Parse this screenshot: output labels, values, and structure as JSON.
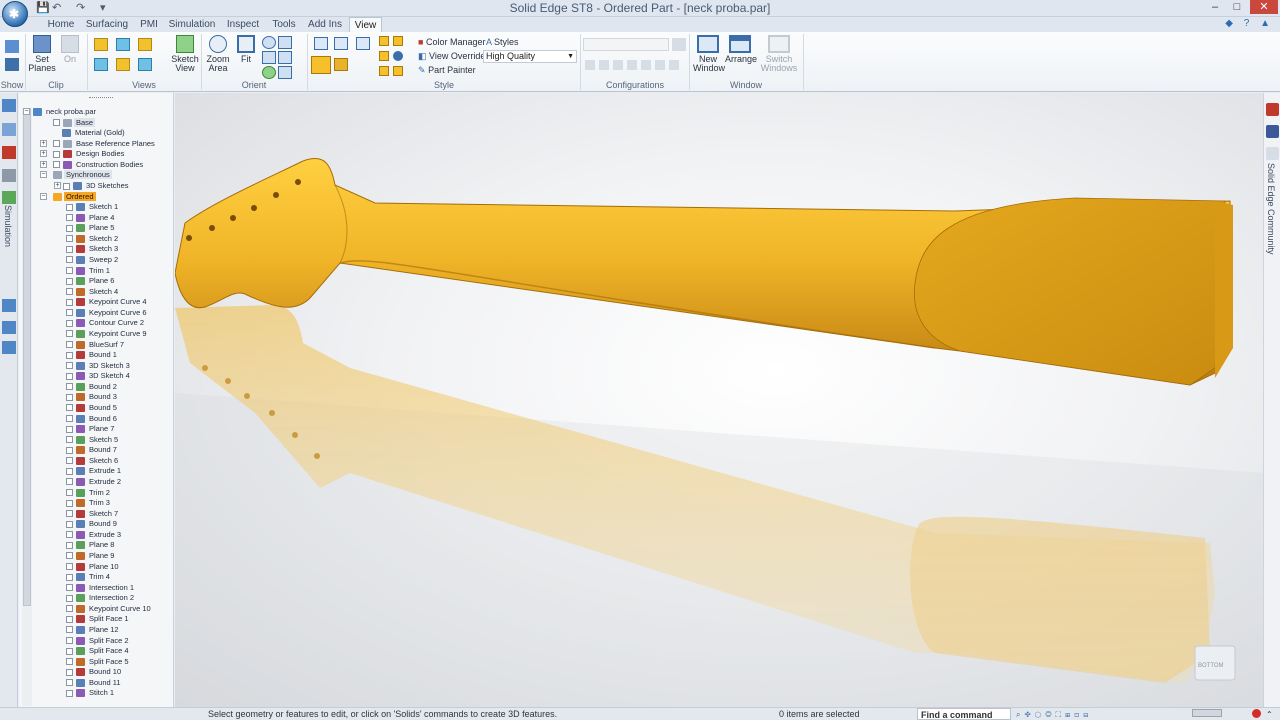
{
  "window": {
    "title": "Solid Edge ST8 - Ordered Part - [neck proba.par]",
    "controls": [
      "–",
      "□",
      "✕"
    ]
  },
  "ribbon": {
    "tabs": [
      "Home",
      "Surfacing",
      "PMI",
      "Simulation",
      "Inspect",
      "Tools",
      "Add Ins",
      "View"
    ],
    "active_tab": "View",
    "groups": {
      "show": "Show",
      "clip": "Clip",
      "views": "Views",
      "orient": "Orient",
      "style": "Style",
      "configurations": "Configurations",
      "window": "Window"
    },
    "buttons": {
      "set_planes": "Set Planes",
      "on": "On",
      "sketch_view": "Sketch View",
      "zoom_area": "Zoom Area",
      "fit": "Fit",
      "color_manager": "Color Manager",
      "styles": "Styles",
      "view_overrides": "View Overrides",
      "view_style_value": "High Quality",
      "part_painter": "Part Painter",
      "new_window": "New Window",
      "arrange": "Arrange",
      "switch_windows": "Switch Windows"
    }
  },
  "side_panels": {
    "left_label": "Simulation",
    "right_label": "Solid Edge Community"
  },
  "tree": {
    "root": "neck proba.par",
    "base_items": [
      "Base",
      "Material (Gold)",
      "Base Reference Planes",
      "Design Bodies",
      "Construction Bodies"
    ],
    "synchronous": "Synchronous",
    "sync_children": [
      "3D Sketches"
    ],
    "ordered": "Ordered",
    "features": [
      "Sketch 1",
      "Plane 4",
      "Plane 5",
      "Sketch 2",
      "Sketch 3",
      "Sweep 2",
      "Trim 1",
      "Plane 6",
      "Sketch 4",
      "Keypoint Curve 4",
      "Keypoint Curve 6",
      "Contour Curve 2",
      "Keypoint Curve 9",
      "BlueSurf 7",
      "Bound 1",
      "3D Sketch 3",
      "3D Sketch 4",
      "Bound 2",
      "Bound 3",
      "Bound 5",
      "Bound 6",
      "Plane 7",
      "Sketch 5",
      "Bound 7",
      "Sketch 6",
      "Extrude 1",
      "Extrude 2",
      "Trim 2",
      "Trim 3",
      "Sketch 7",
      "Bound 9",
      "Extrude 3",
      "Plane 8",
      "Plane 9",
      "Plane 10",
      "Trim 4",
      "Intersection 1",
      "Intersection 2",
      "Keypoint Curve 10",
      "Split Face 1",
      "Plane 12",
      "Split Face 2",
      "Split Face 4",
      "Split Face 5",
      "Bound 10",
      "Bound 11",
      "Stitch 1"
    ]
  },
  "viewport": {
    "view_cube_label": "BOTTOM",
    "model_color": "#f0b428"
  },
  "status": {
    "prompt": "Select geometry or features to edit, or click on 'Solids' commands to create 3D features.",
    "selection": "0 items are selected",
    "find_command": "Find a command"
  }
}
